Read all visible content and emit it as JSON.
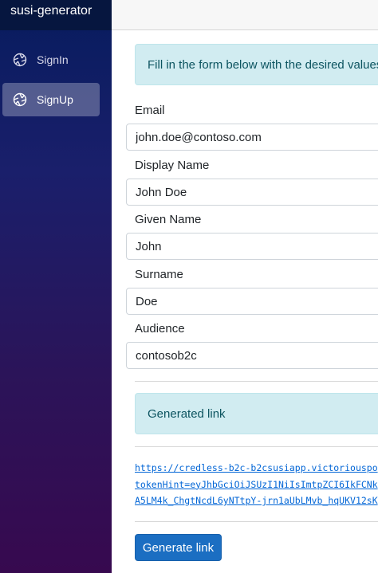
{
  "app": {
    "title": "susi-generator"
  },
  "nav": {
    "items": [
      {
        "label": "SignIn",
        "icon": "aperture-icon",
        "active": false
      },
      {
        "label": "SignUp",
        "icon": "aperture-icon",
        "active": true
      }
    ]
  },
  "form": {
    "instructions": "Fill in the form below with the desired values.",
    "fields": [
      {
        "label": "Email",
        "value": "john.doe@contoso.com"
      },
      {
        "label": "Display Name",
        "value": "John Doe"
      },
      {
        "label": "Given Name",
        "value": "John"
      },
      {
        "label": "Surname",
        "value": "Doe"
      },
      {
        "label": "Audience",
        "value": "contosob2c"
      }
    ]
  },
  "result": {
    "heading": "Generated link",
    "link_lines": [
      "https://credless-b2c-b2csusiapp.victoriouspo",
      "tokenHint=eyJhbGciOiJSUzI1NiIsImtpZCI6IkFCNk",
      "A5LM4k_ChgtNcdL6yNTtpY-jrn1aUbLMvb_hqUKV12sK"
    ]
  },
  "actions": {
    "generate_label": "Generate link"
  },
  "colors": {
    "accent": "#1b6ec2",
    "alert_bg": "#d1ecf1",
    "alert_text": "#0c5460",
    "brand_bar": "#06163f"
  }
}
